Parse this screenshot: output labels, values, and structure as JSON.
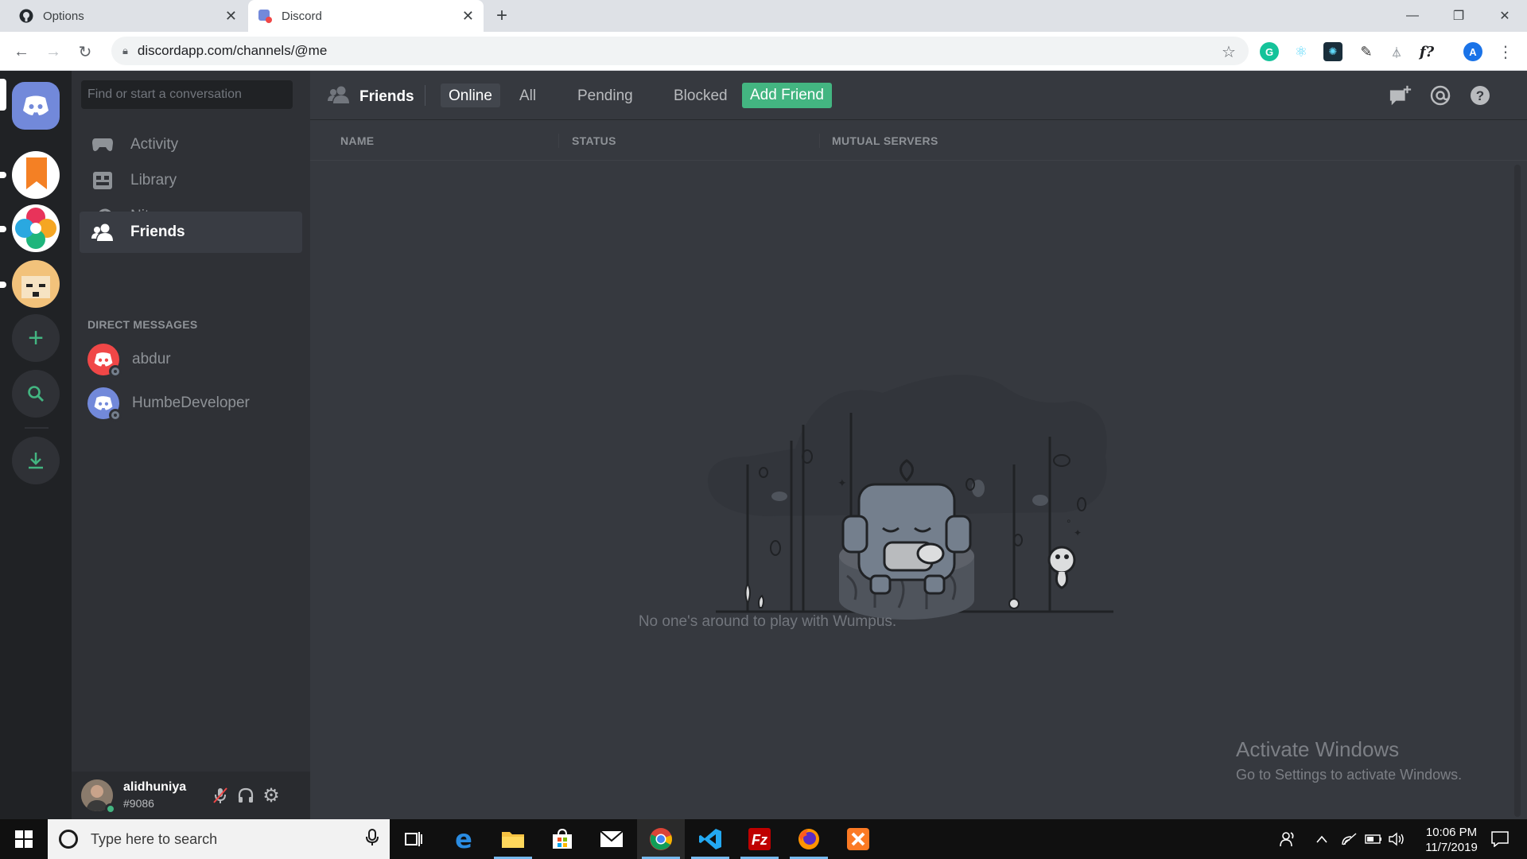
{
  "browser": {
    "tabs": [
      {
        "title": "Options",
        "active": false
      },
      {
        "title": "Discord",
        "active": true
      }
    ],
    "url": "discordapp.com/channels/@me",
    "profile_initial": "A"
  },
  "discord": {
    "search_placeholder": "Find or start a conversation",
    "nav": [
      {
        "label": "Activity",
        "icon": "gamepad-icon",
        "selected": false
      },
      {
        "label": "Library",
        "icon": "library-icon",
        "selected": false
      },
      {
        "label": "Nitro",
        "icon": "nitro-icon",
        "selected": false
      },
      {
        "label": "Friends",
        "icon": "friends-icon",
        "selected": true
      }
    ],
    "dm_header": "DIRECT MESSAGES",
    "dms": [
      {
        "name": "abdur",
        "avatar_color": "#f04747"
      },
      {
        "name": "HumbeDeveloper",
        "avatar_color": "#7289da"
      }
    ],
    "user": {
      "name": "alidhuniya",
      "tag": "#9086",
      "status_color": "#43b581"
    },
    "header": {
      "title": "Friends",
      "tabs": [
        {
          "label": "Online",
          "active": true
        },
        {
          "label": "All",
          "active": false
        },
        {
          "label": "Pending",
          "active": false
        },
        {
          "label": "Blocked",
          "active": false
        }
      ],
      "add_friend": "Add Friend"
    },
    "columns": [
      "NAME",
      "STATUS",
      "MUTUAL SERVERS"
    ],
    "empty_text": "No one's around to play with Wumpus.",
    "colors": {
      "blurple": "#7289da",
      "green": "#43b581",
      "bg": "#36393f",
      "sidebar": "#2f3136",
      "guilds": "#202225"
    }
  },
  "watermark": {
    "title": "Activate Windows",
    "subtitle": "Go to Settings to activate Windows."
  },
  "taskbar": {
    "search_placeholder": "Type here to search",
    "time": "10:06 PM",
    "date": "11/7/2019"
  }
}
